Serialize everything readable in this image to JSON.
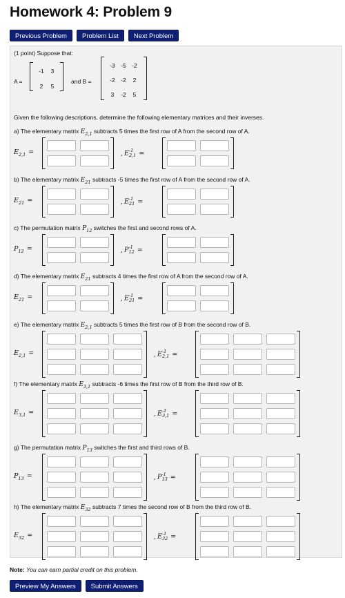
{
  "title": "Homework 4: Problem 9",
  "nav": {
    "previous": "Previous Problem",
    "list": "Problem List",
    "next": "Next Problem"
  },
  "intro": "(1 point) Suppose that:",
  "matrixA": {
    "label": "A =",
    "rows": [
      [
        "-1",
        "3"
      ],
      [
        "2",
        "5"
      ]
    ]
  },
  "and_b": "and B =",
  "matrixB": {
    "rows": [
      [
        "-3",
        "-5",
        "-2"
      ],
      [
        "-2",
        "-2",
        "2"
      ],
      [
        "3",
        "-2",
        "5"
      ]
    ]
  },
  "instructions": "Given the following descriptions, determine the following elementary matrices and their inverses.",
  "parts": [
    {
      "letter": "a) The elementary matrix",
      "sym": "E",
      "sub": "2,1",
      "desc": "subtracts 5 times the first row of A from the second row of A.",
      "size": 2,
      "inv": "-1"
    },
    {
      "letter": "b) The elementary matrix",
      "sym": "E",
      "sub": "21",
      "desc": "subtracts -5 times the first row of A from the second row of A.",
      "size": 2,
      "inv": "-1"
    },
    {
      "letter": "c) The permutation matrix",
      "sym": "P",
      "sub": "12",
      "desc": "switches the first and second rows of A.",
      "size": 2,
      "inv": "-1"
    },
    {
      "letter": "d) The elementary matrix",
      "sym": "E",
      "sub": "21",
      "desc": "subtracts 4 times the first row of A from the second row of A.",
      "size": 2,
      "inv": "-1"
    },
    {
      "letter": "e) The elementary matrix",
      "sym": "E",
      "sub": "2,1",
      "desc": "subtracts 5 times the first row of B from the second row of B.",
      "size": 3,
      "inv": "-1"
    },
    {
      "letter": "f) The elementary matrix",
      "sym": "E",
      "sub": "3,1",
      "desc": "subtracts -6 times the first row of B from the third row of B.",
      "size": 3,
      "inv": "-1"
    },
    {
      "letter": "g) The permutation matrix",
      "sym": "P",
      "sub": "13",
      "desc": "switches the first and third rows of B.",
      "size": 3,
      "inv": "-1"
    },
    {
      "letter": "h) The elementary matrix",
      "sym": "E",
      "sub": "32",
      "desc": "subtracts 7 times the second row of B from the third row of B.",
      "size": 3,
      "inv": "-1"
    }
  ],
  "eq": "=",
  "comma": ",",
  "note": {
    "label": "Note:",
    "text": "You can earn partial credit on this problem."
  },
  "buttons": {
    "preview": "Preview My Answers",
    "submit": "Submit Answers"
  }
}
